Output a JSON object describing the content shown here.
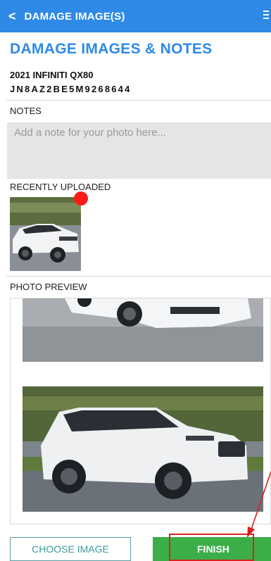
{
  "header": {
    "back_icon": "chevron-left-icon",
    "back_glyph": "<",
    "title": "DAMAGE IMAGE(S)",
    "menu_icon": "hamburger-menu-icon"
  },
  "page": {
    "title": "DAMAGE IMAGES & NOTES"
  },
  "vehicle": {
    "name": "2021 INFINITI QX80",
    "vin": "JN8AZ2BE5M9268644"
  },
  "notes": {
    "label": "NOTES",
    "placeholder": "Add a note for your photo here...",
    "value": ""
  },
  "recent": {
    "label": "RECENTLY UPLOADED",
    "badge_color": "#ff1a1a"
  },
  "preview": {
    "label": "PHOTO PREVIEW"
  },
  "actions": {
    "choose_label": "CHOOSE IMAGE",
    "finish_label": "FINISH"
  },
  "colors": {
    "header": "#2e8ae6",
    "title": "#2e8ae6",
    "finish": "#3cae49",
    "choose_border": "#5b9c9c",
    "highlight": "#d92222"
  }
}
